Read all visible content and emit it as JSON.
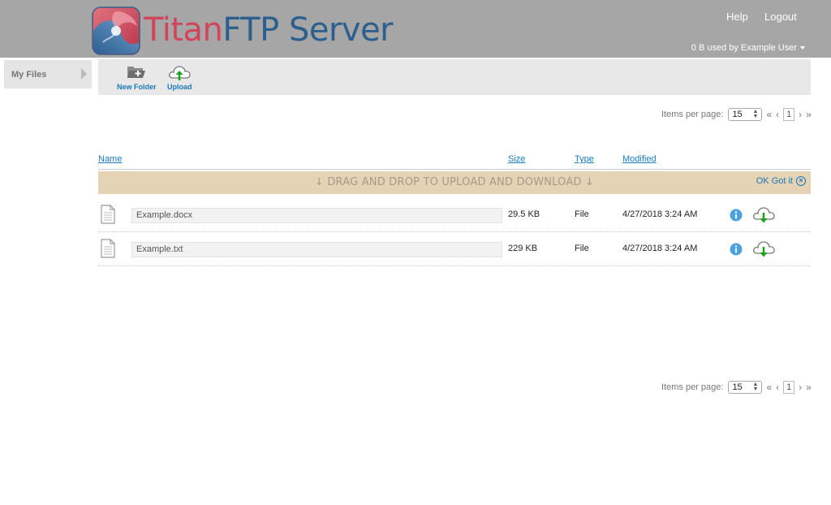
{
  "header": {
    "brand_part1": "Titan",
    "brand_part2": "FTP Server",
    "help": "Help",
    "logout": "Logout",
    "usage_text": "0 B used by",
    "user_name": "Example User"
  },
  "sidebar": {
    "items": [
      {
        "label": "My Files",
        "icon": "chevron-right-icon"
      }
    ]
  },
  "toolbar": {
    "new_folder": "New Folder",
    "upload": "Upload"
  },
  "pager": {
    "label": "Items per page:",
    "per_page": "15",
    "first": "«",
    "prev": "‹",
    "current_page": "1",
    "next": "›",
    "last": "»"
  },
  "columns": {
    "name": "Name",
    "size": "Size",
    "type": "Type",
    "modified": "Modified"
  },
  "banner": {
    "text": "↓ DRAG AND DROP TO UPLOAD AND DOWNLOAD ↓",
    "ok": "OK Got it",
    "close_icon": "close-circle-icon"
  },
  "files": [
    {
      "name": "Example.docx",
      "size": "29.5 KB",
      "type": "File",
      "modified": "4/27/2018 3:24 AM"
    },
    {
      "name": "Example.txt",
      "size": "229 KB",
      "type": "File",
      "modified": "4/27/2018 3:24 AM"
    }
  ],
  "colors": {
    "header_bg": "#a6a6a6",
    "brand_red": "#d24459",
    "brand_blue": "#2b5f8e",
    "link_blue": "#1a7ab8",
    "banner_bg": "#e5d3b5",
    "download_green": "#1aa31a",
    "info_blue": "#4aa3df"
  }
}
